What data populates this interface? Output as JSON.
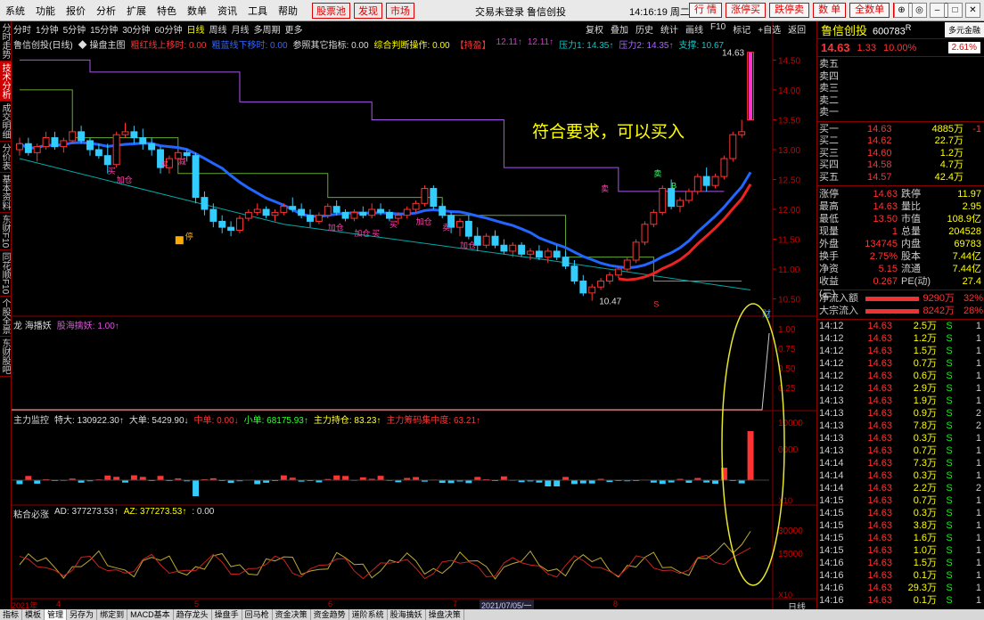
{
  "menu": [
    "系统",
    "功能",
    "报价",
    "分析",
    "扩展",
    "特色",
    "数单",
    "资讯",
    "工具",
    "帮助"
  ],
  "menu_red": [
    "股票池",
    "发现",
    "市场"
  ],
  "window_title": "交易未登录  鲁信创投",
  "clock": "14:16:19 周二",
  "top_buttons": [
    "行  情",
    "涨停买",
    "跌停卖",
    "数  单",
    "全数单",
    "交  易",
    "网  站"
  ],
  "window_controls": [
    "⊕",
    "◎",
    "–",
    "□",
    "✕"
  ],
  "left_tabs": [
    "分时走势",
    "技术分析",
    "成交明细",
    "分价表",
    "基本资料",
    "东财F10",
    "同花顺F10",
    "个股全景",
    "东财股吧"
  ],
  "periods": [
    "分时",
    "1分钟",
    "5分钟",
    "15分钟",
    "30分钟",
    "60分钟",
    "日线",
    "周线",
    "月线",
    "多周期",
    "更多"
  ],
  "active_period": "日线",
  "chart_toolbar": [
    "复权",
    "叠加",
    "历史",
    "统计",
    "画线",
    "F10",
    "标记",
    "+自选",
    "返回"
  ],
  "main_info": [
    {
      "t": "鲁信创投(日线)",
      "c": "#dddddd"
    },
    {
      "t": "◆ 操盘主图",
      "c": "#dddddd"
    },
    {
      "t": "粗红线上移时: 0.00",
      "c": "#ff3333"
    },
    {
      "t": "粗蓝线下移时: 0.00",
      "c": "#3366ff"
    },
    {
      "t": "参照其它指标: 0.00",
      "c": "#dddddd"
    },
    {
      "t": "综合判断操作: 0.00",
      "c": "#ffff00"
    },
    {
      "t": "【持盈】",
      "c": "#ff3333"
    },
    {
      "t": "12.11↑",
      "c": "#dd33dd"
    },
    {
      "t": "12.11↑",
      "c": "#dd33dd"
    },
    {
      "t": "压力1: 14.35↑",
      "c": "#00cccc"
    },
    {
      "t": "压力2: 14.35↑",
      "c": "#aa66ff"
    },
    {
      "t": "支撑: 10.67",
      "c": "#00cccc"
    }
  ],
  "main_axis": [
    "14.50",
    "14.00",
    "13.50",
    "13.00",
    "12.50",
    "12.00",
    "11.50",
    "11.00",
    "10.50"
  ],
  "annotations": {
    "high": "14.63",
    "low": "10.47",
    "overlay": "符合要求，可以买入",
    "signals": [
      "买",
      "买",
      "加仓",
      "减",
      "买",
      "加仓",
      "加仓",
      "加仓",
      "买",
      "卖",
      "卖",
      "加仓",
      "卖",
      "B",
      "S"
    ],
    "stop": "停"
  },
  "panel2": {
    "header": [
      "龙 海播妖",
      "股海擒妖: 1.00↑"
    ],
    "axis": [
      "1.00",
      "0.75",
      "0.50",
      "0.25"
    ],
    "marker": "财"
  },
  "panel3": {
    "header": [
      "主力监控",
      "特大: 130922.30↑",
      "大单: 5429.90↓",
      "中单: 0.00↓",
      "小单: 68175.93↑",
      "主力持仓: 83.23↑",
      "主力筹码集中度: 63.21↑"
    ],
    "axis": [
      "10000",
      "0000"
    ],
    "unit": "X10"
  },
  "panel4": {
    "header": [
      "粘合必涨",
      "AD: 377273.53↑",
      "AZ: 377273.53↑",
      ": 0.00"
    ],
    "axis": [
      "30000",
      "15000"
    ],
    "unit": "X10"
  },
  "dates": [
    "2021年",
    "4",
    "5",
    "6",
    "2021/07/05/一",
    "7",
    "8"
  ],
  "bottom_tabs": [
    "指标",
    "模板",
    "管理",
    "另存为",
    "绑定到",
    "MACD基本",
    "趋存龙头",
    "操盘手",
    "回马枪",
    "资金决策",
    "资金趋势",
    "道阶系统",
    "股海擒妖",
    "操盘决策"
  ],
  "period_label_bottom": "日线",
  "quote": {
    "name": "鲁信创投",
    "code": "600783",
    "code_sup": "R",
    "tag": "多元金融",
    "price": "14.63",
    "change": "1.33",
    "change_pct": "10.00%",
    "pct_box": "2.61%",
    "asks": [
      {
        "label": "卖五",
        "price": "",
        "vol": "",
        "e": ""
      },
      {
        "label": "卖四",
        "price": "",
        "vol": "",
        "e": ""
      },
      {
        "label": "卖三",
        "price": "",
        "vol": "",
        "e": ""
      },
      {
        "label": "卖二",
        "price": "",
        "vol": "",
        "e": ""
      },
      {
        "label": "卖一",
        "price": "",
        "vol": "",
        "e": ""
      }
    ],
    "bids": [
      {
        "label": "买一",
        "price": "14.63",
        "vol": "4885万",
        "e": "-1"
      },
      {
        "label": "买二",
        "price": "14.62",
        "vol": "22.7万",
        "e": ""
      },
      {
        "label": "买三",
        "price": "14.60",
        "vol": "1.2万",
        "e": ""
      },
      {
        "label": "买四",
        "price": "14.58",
        "vol": "4.7万",
        "e": ""
      },
      {
        "label": "买五",
        "price": "14.57",
        "vol": "42.4万",
        "e": ""
      }
    ],
    "stats": [
      [
        "涨停",
        "14.63",
        "跌停",
        "11.97"
      ],
      [
        "最高",
        "14.63",
        "量比",
        "2.95"
      ],
      [
        "最低",
        "13.50",
        "市值",
        "108.9亿"
      ],
      [
        "现量",
        "1",
        "总量",
        "204528"
      ],
      [
        "外盘",
        "134745",
        "内盘",
        "69783"
      ],
      [
        "换手",
        "2.75%",
        "股本",
        "7.44亿"
      ],
      [
        "净资",
        "5.15",
        "流通",
        "7.44亿"
      ],
      [
        "收益(三)",
        "0.267",
        "PE(动)",
        "27.4"
      ]
    ],
    "flow": [
      {
        "label": "净流入额",
        "val": "9290万",
        "pct": "32%"
      },
      {
        "label": "大宗流入",
        "val": "8242万",
        "pct": "28%"
      }
    ],
    "ticks": [
      [
        "14:12",
        "14.63",
        "2.5万",
        "S",
        "1"
      ],
      [
        "14:12",
        "14.63",
        "1.2万",
        "S",
        "1"
      ],
      [
        "14:12",
        "14.63",
        "1.5万",
        "S",
        "1"
      ],
      [
        "14:12",
        "14.63",
        "0.7万",
        "S",
        "1"
      ],
      [
        "14:12",
        "14.63",
        "0.6万",
        "S",
        "1"
      ],
      [
        "14:12",
        "14.63",
        "2.9万",
        "S",
        "1"
      ],
      [
        "14:13",
        "14.63",
        "1.9万",
        "S",
        "1"
      ],
      [
        "14:13",
        "14.63",
        "0.9万",
        "S",
        "2"
      ],
      [
        "14:13",
        "14.63",
        "7.8万",
        "S",
        "2"
      ],
      [
        "14:13",
        "14.63",
        "0.3万",
        "S",
        "1"
      ],
      [
        "14:13",
        "14.63",
        "0.7万",
        "S",
        "1"
      ],
      [
        "14:14",
        "14.63",
        "7.3万",
        "S",
        "1"
      ],
      [
        "14:14",
        "14.63",
        "0.3万",
        "S",
        "1"
      ],
      [
        "14:14",
        "14.63",
        "2.2万",
        "S",
        "2"
      ],
      [
        "14:15",
        "14.63",
        "0.7万",
        "S",
        "1"
      ],
      [
        "14:15",
        "14.63",
        "0.3万",
        "S",
        "1"
      ],
      [
        "14:15",
        "14.63",
        "3.8万",
        "S",
        "1"
      ],
      [
        "14:15",
        "14.63",
        "1.6万",
        "S",
        "1"
      ],
      [
        "14:15",
        "14.63",
        "1.0万",
        "S",
        "1"
      ],
      [
        "14:16",
        "14.63",
        "1.5万",
        "S",
        "1"
      ],
      [
        "14:16",
        "14.63",
        "0.1万",
        "S",
        "1"
      ],
      [
        "14:16",
        "14.63",
        "29.3万",
        "S",
        "1"
      ],
      [
        "14:16",
        "14.63",
        "0.1万",
        "S",
        "1"
      ]
    ]
  },
  "colors": {
    "up": "#ff3333",
    "down": "#33ccff",
    "blue_line": "#2266ff",
    "red_line": "#ee2222",
    "purple_line": "#aa55ee",
    "green_line": "#66aa33",
    "magenta": "#ff33cc",
    "yellow": "#ffff00",
    "ellipse": "#e6e62a"
  },
  "chart_data": [
    {
      "type": "candlestick",
      "title": "鲁信创投(日线)",
      "y_range": [
        10.3,
        14.7
      ],
      "note": "approximate daily OHLC read from chart",
      "ohlc": [
        [
          13.0,
          13.2,
          12.9,
          13.1
        ],
        [
          13.1,
          13.2,
          12.9,
          12.95
        ],
        [
          12.95,
          13.1,
          12.8,
          13.05
        ],
        [
          13.05,
          13.3,
          13.0,
          13.2
        ],
        [
          13.2,
          13.3,
          13.0,
          13.05
        ],
        [
          13.05,
          13.2,
          12.95,
          13.15
        ],
        [
          13.15,
          13.35,
          13.1,
          13.3
        ],
        [
          13.3,
          13.4,
          13.1,
          13.15
        ],
        [
          13.15,
          13.2,
          12.9,
          13.0
        ],
        [
          13.0,
          13.1,
          12.85,
          12.9
        ],
        [
          12.9,
          13.1,
          12.6,
          12.75
        ],
        [
          12.75,
          13.3,
          12.7,
          13.25
        ],
        [
          13.25,
          13.45,
          13.2,
          13.3
        ],
        [
          13.3,
          13.4,
          13.1,
          13.2
        ],
        [
          13.2,
          13.35,
          13.0,
          13.1
        ],
        [
          13.1,
          13.2,
          12.9,
          13.0
        ],
        [
          13.0,
          13.05,
          12.6,
          12.7
        ],
        [
          12.7,
          12.9,
          12.6,
          12.85
        ],
        [
          12.85,
          13.0,
          12.8,
          12.95
        ],
        [
          12.95,
          13.0,
          12.8,
          12.9
        ],
        [
          12.9,
          12.95,
          12.1,
          12.2
        ],
        [
          12.2,
          12.3,
          11.9,
          12.0
        ],
        [
          12.0,
          12.1,
          11.7,
          11.8
        ],
        [
          11.8,
          11.9,
          11.6,
          11.7
        ],
        [
          11.7,
          11.8,
          11.55,
          11.65
        ],
        [
          11.65,
          11.9,
          11.6,
          11.85
        ],
        [
          11.85,
          12.0,
          11.8,
          11.95
        ],
        [
          11.95,
          12.1,
          11.9,
          12.0
        ],
        [
          12.0,
          12.05,
          11.85,
          11.9
        ],
        [
          11.9,
          12.0,
          11.8,
          11.95
        ],
        [
          11.95,
          12.1,
          11.9,
          12.05
        ],
        [
          12.05,
          12.2,
          11.95,
          12.0
        ],
        [
          12.0,
          12.1,
          11.85,
          11.9
        ],
        [
          11.9,
          12.0,
          11.7,
          11.8
        ],
        [
          11.8,
          11.95,
          11.75,
          11.9
        ],
        [
          11.9,
          12.1,
          11.85,
          12.05
        ],
        [
          12.05,
          12.15,
          11.9,
          11.95
        ],
        [
          11.95,
          12.0,
          11.8,
          11.85
        ],
        [
          11.85,
          12.0,
          11.8,
          11.95
        ],
        [
          11.95,
          12.05,
          11.85,
          11.9
        ],
        [
          11.9,
          12.1,
          11.85,
          12.0
        ],
        [
          12.0,
          12.1,
          11.9,
          11.95
        ],
        [
          11.95,
          12.0,
          11.8,
          11.85
        ],
        [
          11.85,
          11.95,
          11.75,
          11.9
        ],
        [
          11.9,
          12.05,
          11.85,
          12.0
        ],
        [
          12.0,
          12.15,
          11.95,
          12.1
        ],
        [
          12.1,
          12.4,
          12.05,
          12.35
        ],
        [
          12.35,
          12.4,
          12.0,
          12.05
        ],
        [
          12.05,
          12.1,
          11.85,
          11.9
        ],
        [
          11.9,
          11.95,
          11.6,
          11.7
        ],
        [
          11.7,
          11.85,
          11.55,
          11.8
        ],
        [
          11.8,
          11.9,
          11.5,
          11.55
        ],
        [
          11.55,
          11.7,
          11.3,
          11.4
        ],
        [
          11.4,
          11.6,
          11.35,
          11.55
        ],
        [
          11.55,
          11.65,
          11.35,
          11.4
        ],
        [
          11.4,
          11.5,
          11.25,
          11.3
        ],
        [
          11.3,
          11.45,
          11.2,
          11.4
        ],
        [
          11.4,
          11.45,
          11.2,
          11.25
        ],
        [
          11.25,
          11.35,
          11.15,
          11.3
        ],
        [
          11.3,
          11.4,
          11.15,
          11.2
        ],
        [
          11.2,
          11.35,
          11.1,
          11.3
        ],
        [
          11.3,
          11.4,
          11.15,
          11.2
        ],
        [
          11.2,
          11.3,
          11.0,
          11.05
        ],
        [
          11.05,
          11.15,
          10.75,
          10.8
        ],
        [
          10.8,
          10.9,
          10.55,
          10.6
        ],
        [
          10.6,
          10.75,
          10.47,
          10.7
        ],
        [
          10.7,
          10.85,
          10.65,
          10.8
        ],
        [
          10.8,
          10.95,
          10.75,
          10.9
        ],
        [
          10.9,
          11.05,
          10.85,
          11.0
        ],
        [
          11.0,
          11.2,
          10.95,
          11.15
        ],
        [
          11.15,
          11.5,
          11.1,
          11.45
        ],
        [
          11.45,
          11.8,
          11.4,
          11.75
        ],
        [
          11.75,
          12.0,
          11.7,
          11.95
        ],
        [
          11.95,
          12.4,
          11.9,
          12.35
        ],
        [
          12.35,
          12.5,
          12.0,
          12.05
        ],
        [
          12.05,
          12.2,
          11.95,
          12.15
        ],
        [
          12.15,
          12.35,
          12.1,
          12.3
        ],
        [
          12.3,
          12.6,
          12.25,
          12.55
        ],
        [
          12.55,
          12.7,
          12.3,
          12.4
        ],
        [
          12.4,
          12.6,
          12.35,
          12.55
        ],
        [
          12.55,
          12.9,
          12.5,
          12.85
        ],
        [
          12.85,
          13.3,
          12.8,
          13.25
        ],
        [
          13.25,
          13.5,
          13.2,
          13.3
        ],
        [
          13.5,
          14.63,
          13.5,
          14.63
        ]
      ]
    }
  ]
}
